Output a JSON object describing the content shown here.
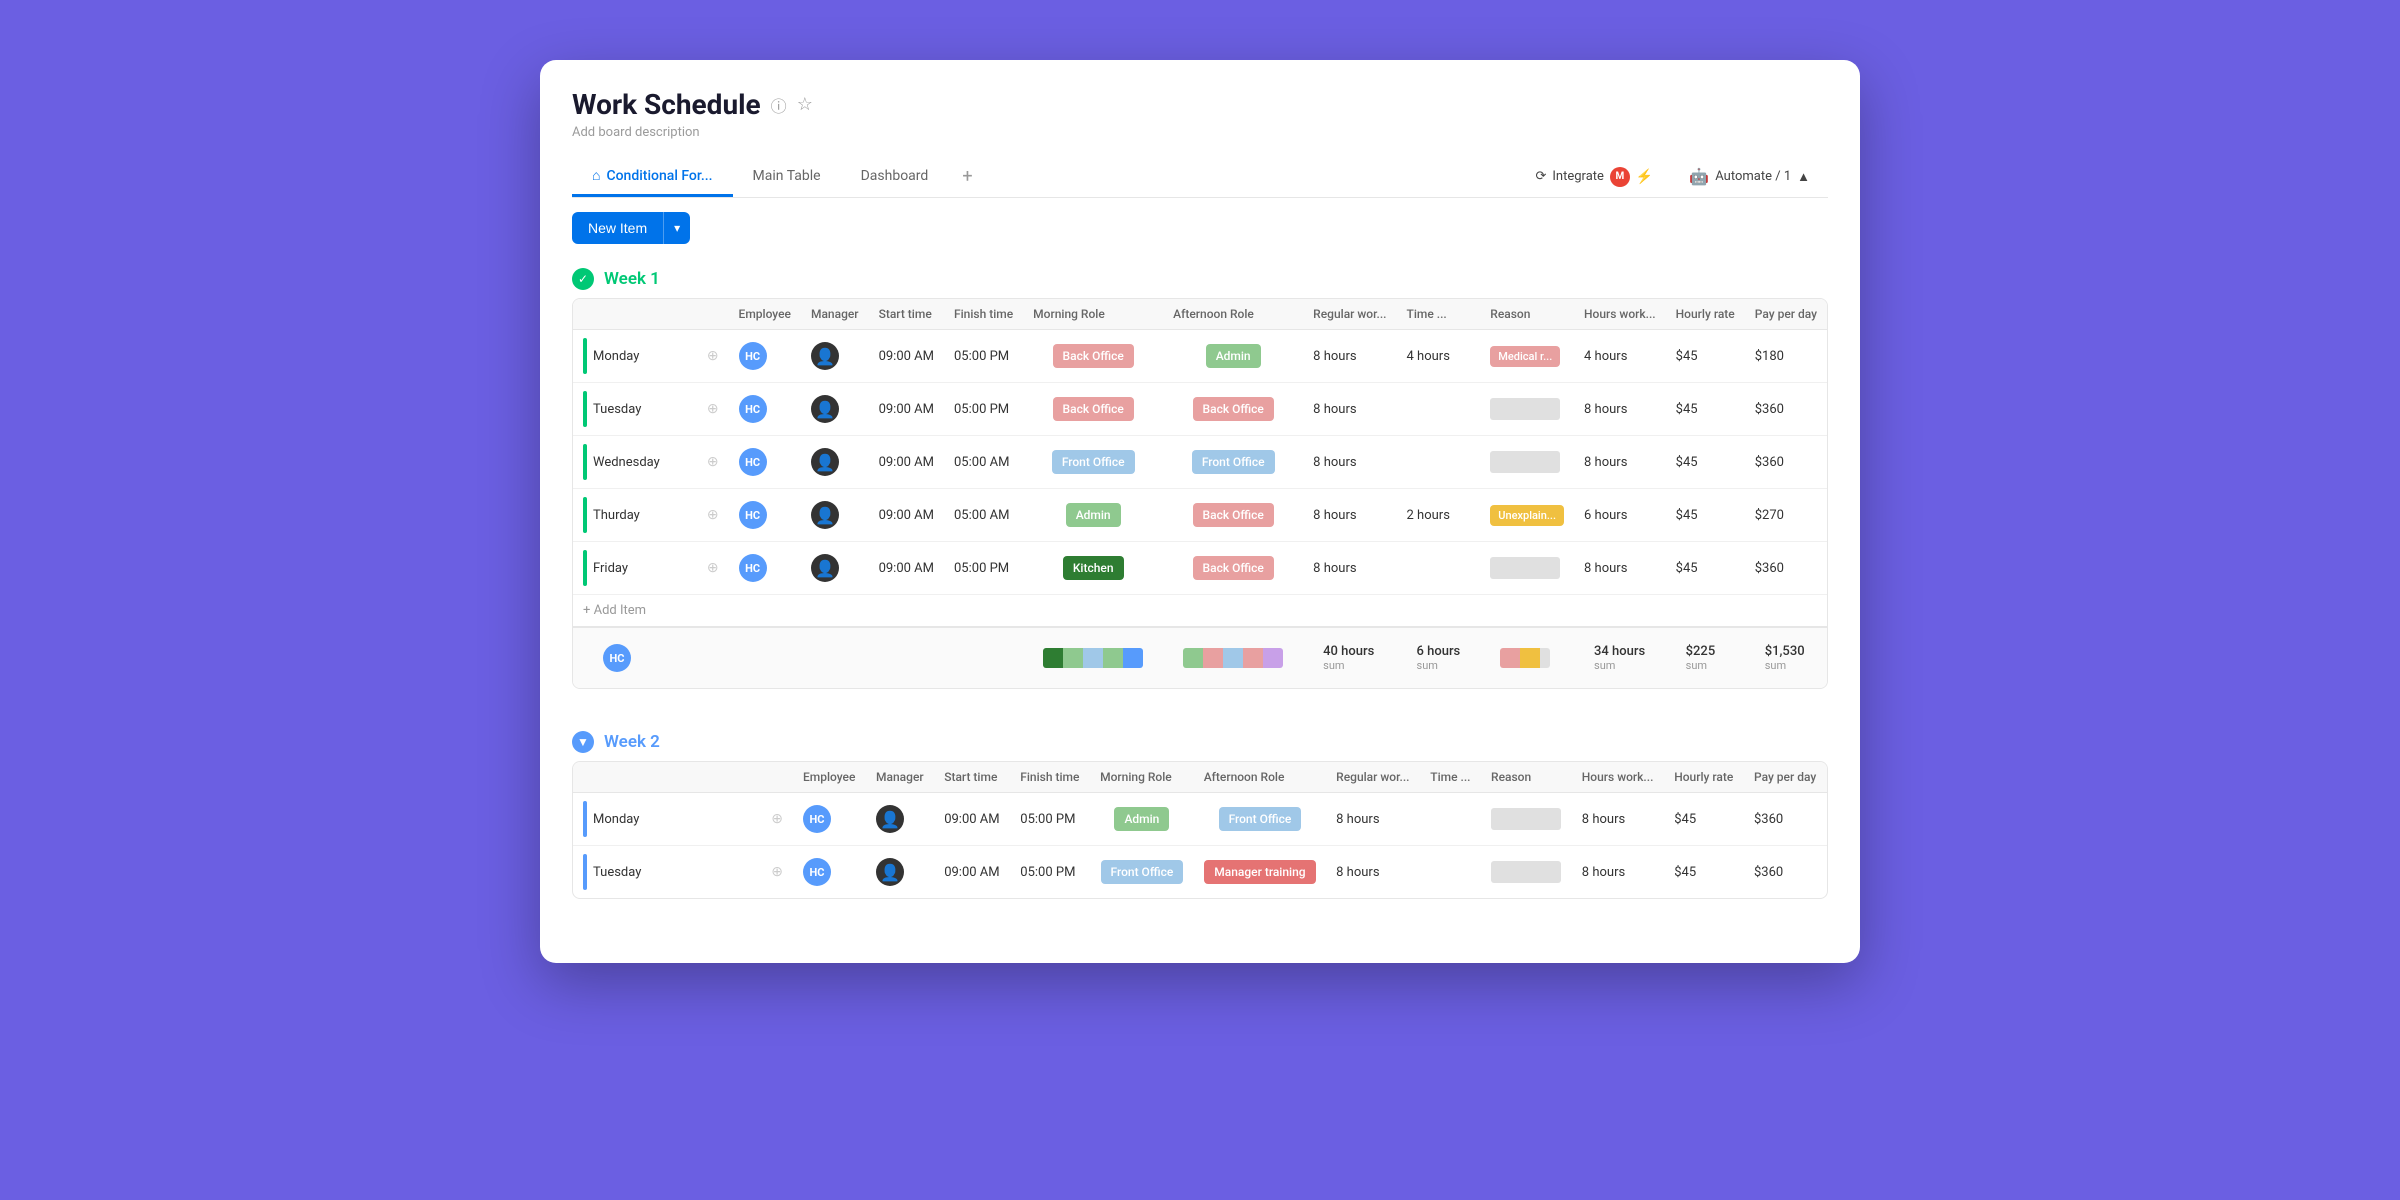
{
  "window": {
    "title": "Work Schedule",
    "description": "Add board description"
  },
  "tabs": [
    {
      "id": "conditional",
      "label": "Conditional For...",
      "icon": "home",
      "active": true
    },
    {
      "id": "main",
      "label": "Main Table",
      "active": false
    },
    {
      "id": "dashboard",
      "label": "Dashboard",
      "active": false
    }
  ],
  "tab_add": "+",
  "toolbar": {
    "new_item_label": "New Item",
    "arrow": "▾"
  },
  "integrate": {
    "label": "Integrate",
    "icon": "⟳"
  },
  "automate": {
    "label": "Automate / 1",
    "icon": "▾"
  },
  "groups": [
    {
      "id": "week1",
      "title": "Week 1",
      "color": "green",
      "columns": [
        "Employee",
        "Manager",
        "Start time",
        "Finish time",
        "Morning Role",
        "Afternoon Role",
        "Regular wor...",
        "Time ...",
        "Reason",
        "Hours work...",
        "Hourly rate",
        "Pay per day"
      ],
      "rows": [
        {
          "day": "Monday",
          "employee": "HC",
          "manager": true,
          "start": "09:00 AM",
          "finish": "05:00 PM",
          "morning_role": "Back Office",
          "morning_color": "back-office",
          "afternoon_role": "Admin",
          "afternoon_color": "admin",
          "regular_hours": "8 hours",
          "time_off": "4 hours",
          "reason": "Medical r...",
          "reason_type": "medical",
          "hours_worked": "4 hours",
          "hourly_rate": "$45",
          "pay_per_day": "$180"
        },
        {
          "day": "Tuesday",
          "employee": "HC",
          "manager": true,
          "start": "09:00 AM",
          "finish": "05:00 PM",
          "morning_role": "Back Office",
          "morning_color": "back-office",
          "afternoon_role": "Back Office",
          "afternoon_color": "back-office",
          "regular_hours": "8 hours",
          "time_off": "",
          "reason": "",
          "reason_type": "none",
          "hours_worked": "8 hours",
          "hourly_rate": "$45",
          "pay_per_day": "$360"
        },
        {
          "day": "Wednesday",
          "employee": "HC",
          "manager": true,
          "start": "09:00 AM",
          "finish": "05:00 AM",
          "morning_role": "Front Office",
          "morning_color": "front-office",
          "afternoon_role": "Front Office",
          "afternoon_color": "front-office",
          "regular_hours": "8 hours",
          "time_off": "",
          "reason": "",
          "reason_type": "none",
          "hours_worked": "8 hours",
          "hourly_rate": "$45",
          "pay_per_day": "$360"
        },
        {
          "day": "Thurday",
          "employee": "HC",
          "manager": true,
          "start": "09:00 AM",
          "finish": "05:00 AM",
          "morning_role": "Admin",
          "morning_color": "admin",
          "afternoon_role": "Back Office",
          "afternoon_color": "back-office",
          "regular_hours": "8 hours",
          "time_off": "2 hours",
          "reason": "Unexplain...",
          "reason_type": "unexplained",
          "hours_worked": "6 hours",
          "hourly_rate": "$45",
          "pay_per_day": "$270"
        },
        {
          "day": "Friday",
          "employee": "HC",
          "manager": true,
          "start": "09:00 AM",
          "finish": "05:00 PM",
          "morning_role": "Kitchen",
          "morning_color": "kitchen",
          "afternoon_role": "Back Office",
          "afternoon_color": "back-office",
          "regular_hours": "8 hours",
          "time_off": "",
          "reason": "",
          "reason_type": "none",
          "hours_worked": "8 hours",
          "hourly_rate": "$45",
          "pay_per_day": "$360"
        }
      ],
      "summary": {
        "regular_hours": "40 hours",
        "time_off": "6 hours",
        "hours_worked": "34 hours",
        "hourly_rate": "$225",
        "pay_per_day": "$1,530"
      },
      "add_item": "+ Add Item"
    },
    {
      "id": "week2",
      "title": "Week 2",
      "color": "blue",
      "columns": [
        "Employee",
        "Manager",
        "Start time",
        "Finish time",
        "Morning Role",
        "Afternoon Role",
        "Regular wor...",
        "Time ...",
        "Reason",
        "Hours work...",
        "Hourly rate",
        "Pay per day"
      ],
      "rows": [
        {
          "day": "Monday",
          "employee": "HC",
          "manager": true,
          "start": "09:00 AM",
          "finish": "05:00 PM",
          "morning_role": "Admin",
          "morning_color": "admin",
          "afternoon_role": "Front Office",
          "afternoon_color": "front-office",
          "regular_hours": "8 hours",
          "time_off": "",
          "reason": "",
          "reason_type": "none",
          "hours_worked": "8 hours",
          "hourly_rate": "$45",
          "pay_per_day": "$360"
        },
        {
          "day": "Tuesday",
          "employee": "HC",
          "manager": true,
          "start": "09:00 AM",
          "finish": "05:00 PM",
          "morning_role": "Front Office",
          "morning_color": "front-office",
          "afternoon_role": "Manager training",
          "afternoon_color": "manager-training",
          "regular_hours": "8 hours",
          "time_off": "",
          "reason": "",
          "reason_type": "none",
          "hours_worked": "8 hours",
          "hourly_rate": "$45",
          "pay_per_day": "$360"
        }
      ],
      "summary": null
    }
  ]
}
